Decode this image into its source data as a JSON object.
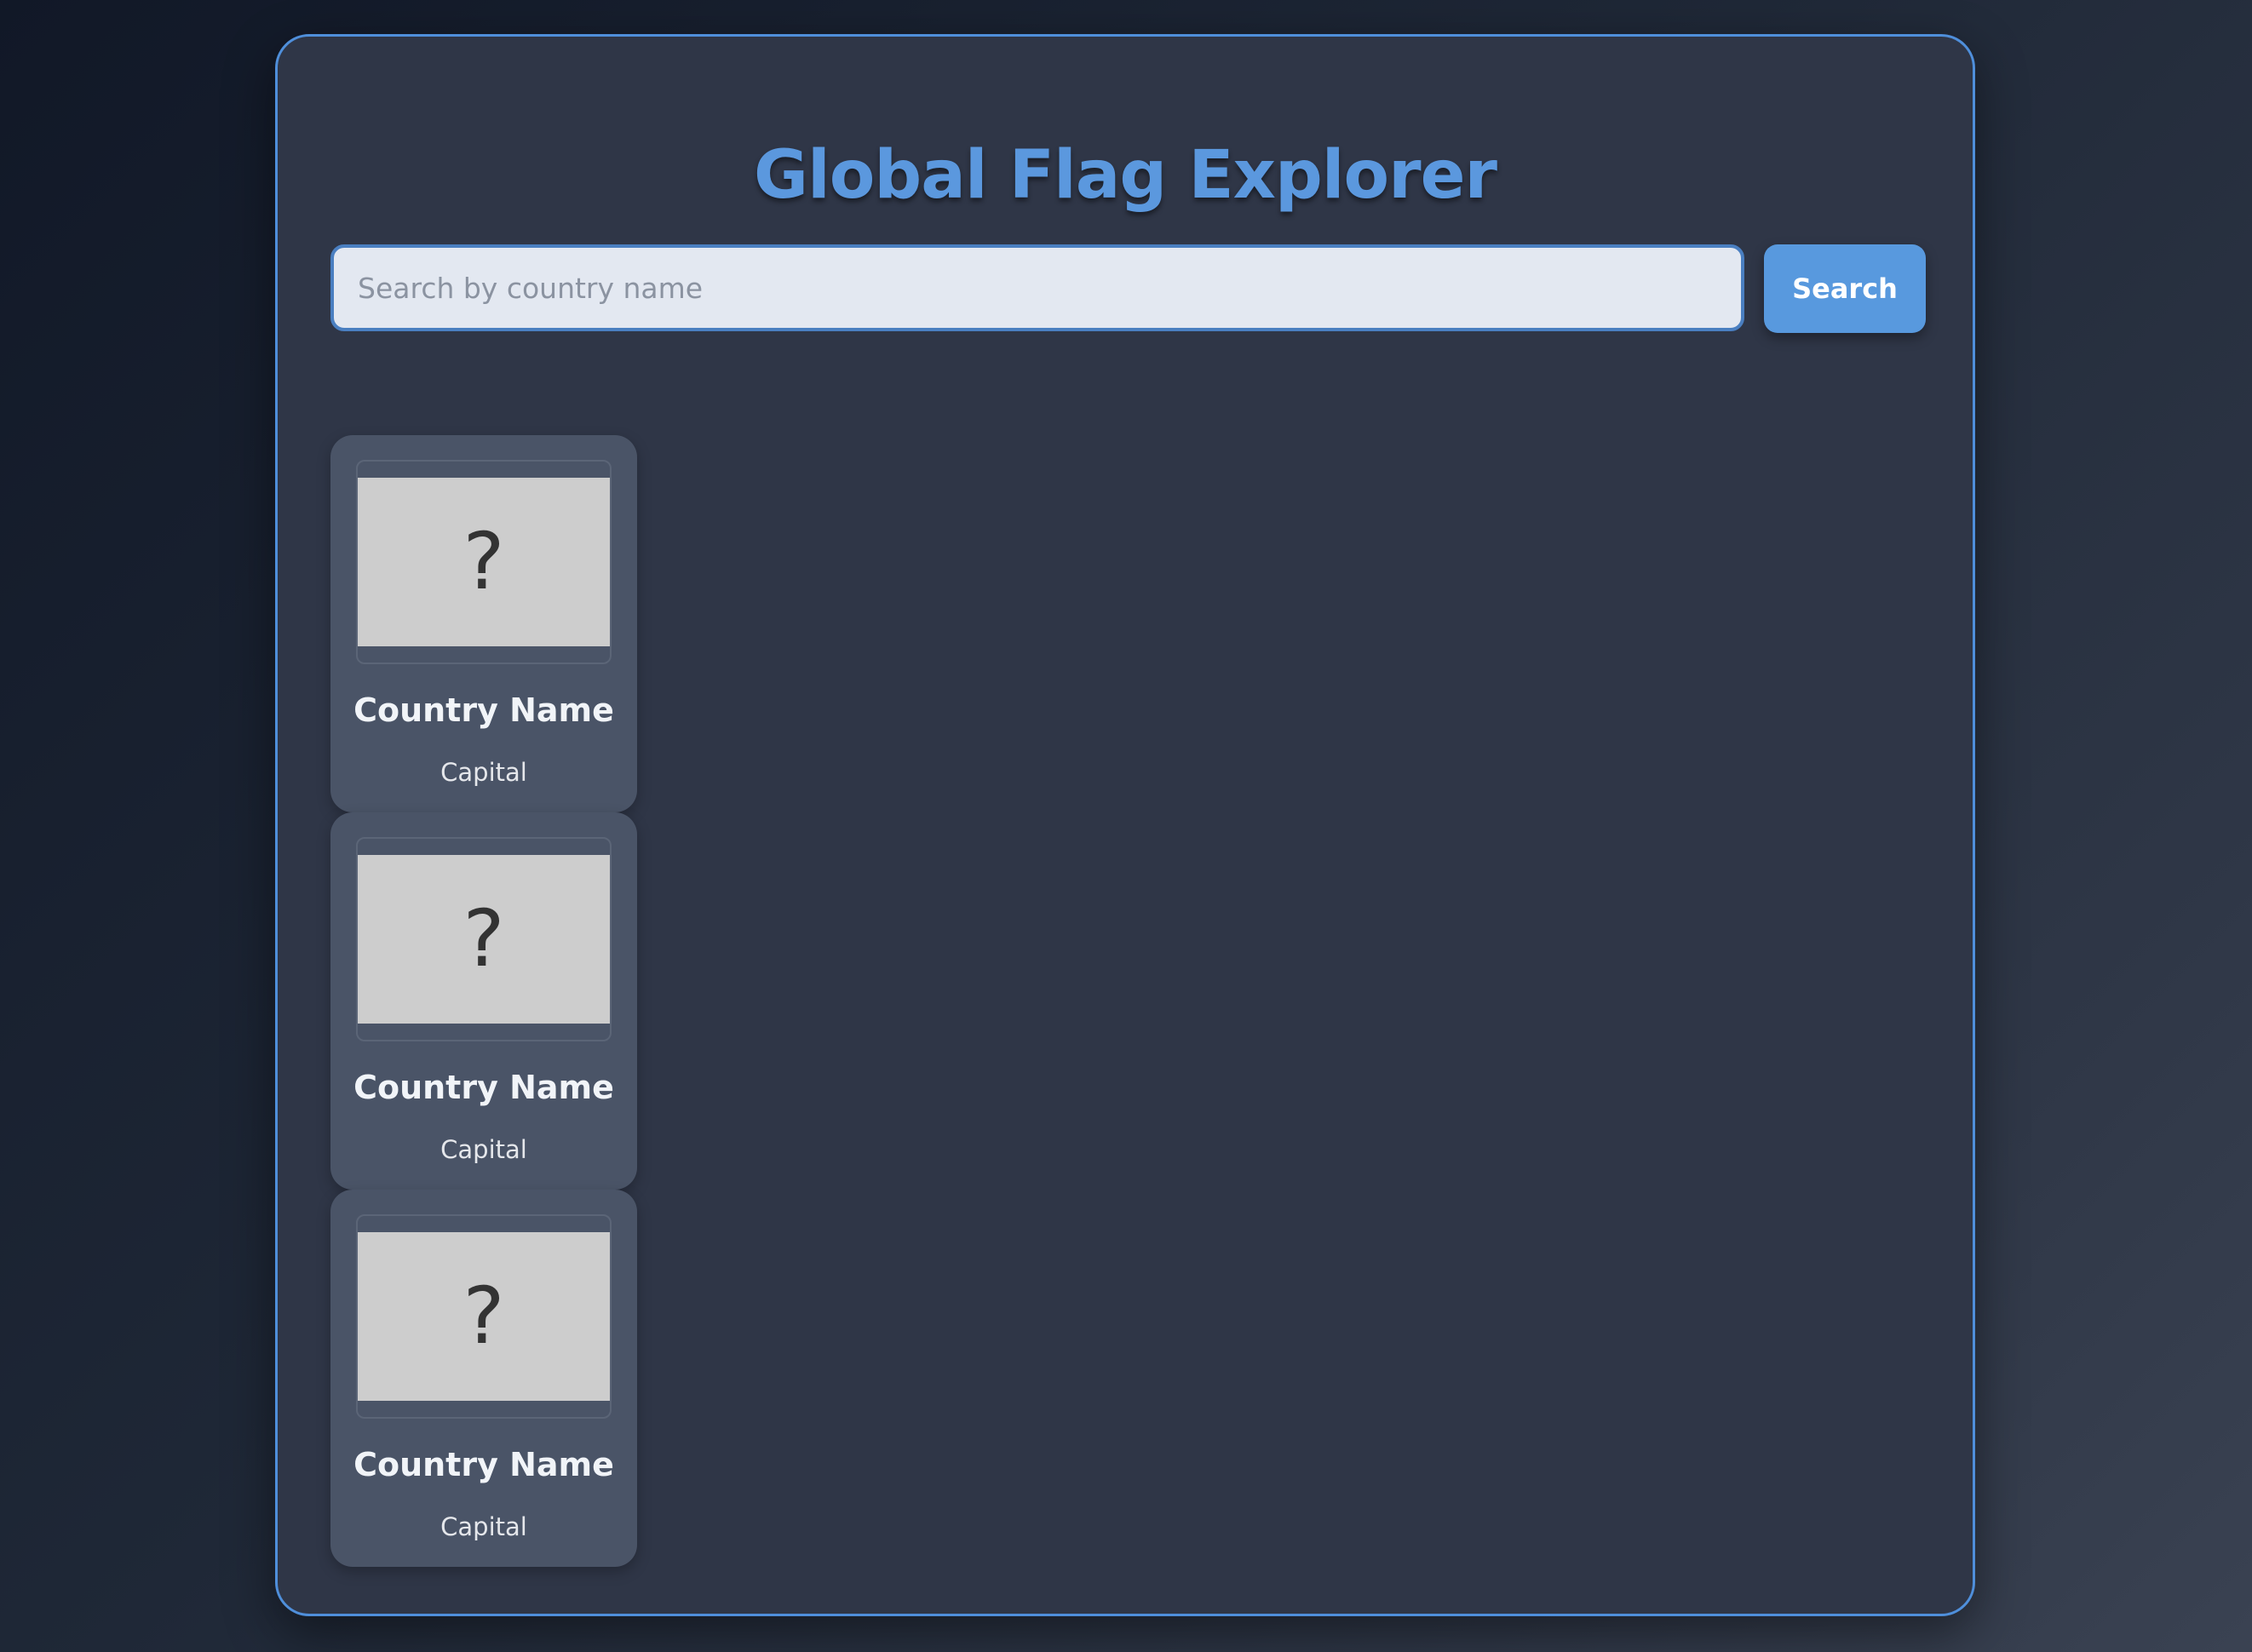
{
  "header": {
    "title": "Global Flag Explorer"
  },
  "search": {
    "placeholder": "Search by country name",
    "value": "",
    "button_label": "Search"
  },
  "countries": [
    {
      "flag_glyph": "?",
      "name": "Country Name",
      "capital": "Capital"
    },
    {
      "flag_glyph": "?",
      "name": "Country Name",
      "capital": "Capital"
    },
    {
      "flag_glyph": "?",
      "name": "Country Name",
      "capital": "Capital"
    }
  ],
  "colors": {
    "accent": "#5899de",
    "card_border": "#4f8fdb",
    "panel": "#2f3647",
    "country_card": "#4a5467",
    "flag_placeholder": "#cdcdcd"
  }
}
